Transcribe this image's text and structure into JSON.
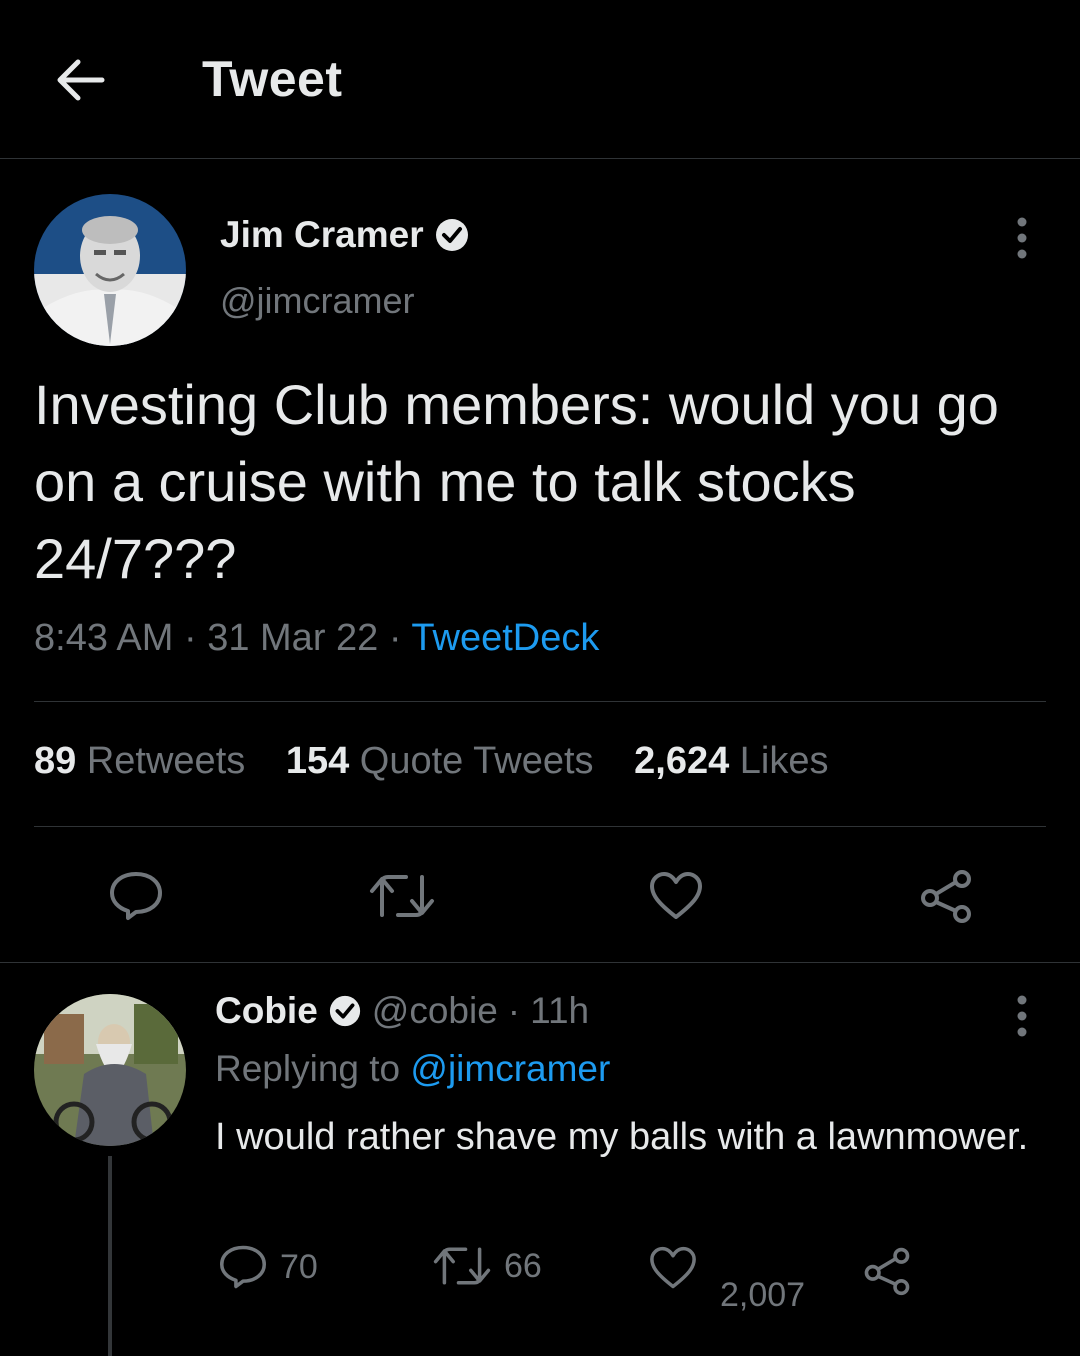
{
  "header": {
    "title": "Tweet",
    "back_icon": "arrow-left-icon"
  },
  "tweet": {
    "author_name": "Jim Cramer",
    "author_handle": "@jimcramer",
    "verified": true,
    "text": "Investing Club members: would you go on a cruise with me to talk stocks 24/7???",
    "time": "8:43 AM",
    "date": "31 Mar 22",
    "source": "TweetDeck",
    "separator": "·",
    "stats": {
      "retweets_count": "89",
      "retweets_label": "Retweets",
      "quotes_count": "154",
      "quotes_label": "Quote Tweets",
      "likes_count": "2,624",
      "likes_label": "Likes"
    },
    "actions": [
      "reply-icon",
      "retweet-icon",
      "like-icon",
      "share-icon"
    ]
  },
  "reply": {
    "author_name": "Cobie",
    "author_handle": "@cobie",
    "verified": true,
    "separator": "·",
    "time_ago": "11h",
    "replying_prefix": "Replying to",
    "replying_to": "@jimcramer",
    "text": "I would rather shave my balls with a lawnmower.",
    "counts": {
      "replies": "70",
      "retweets": "66",
      "likes": "2,007"
    }
  },
  "colors": {
    "background": "#000000",
    "text": "#e7e9ea",
    "muted": "#71767b",
    "accent": "#1d9bf0",
    "divider": "#2f3336"
  }
}
